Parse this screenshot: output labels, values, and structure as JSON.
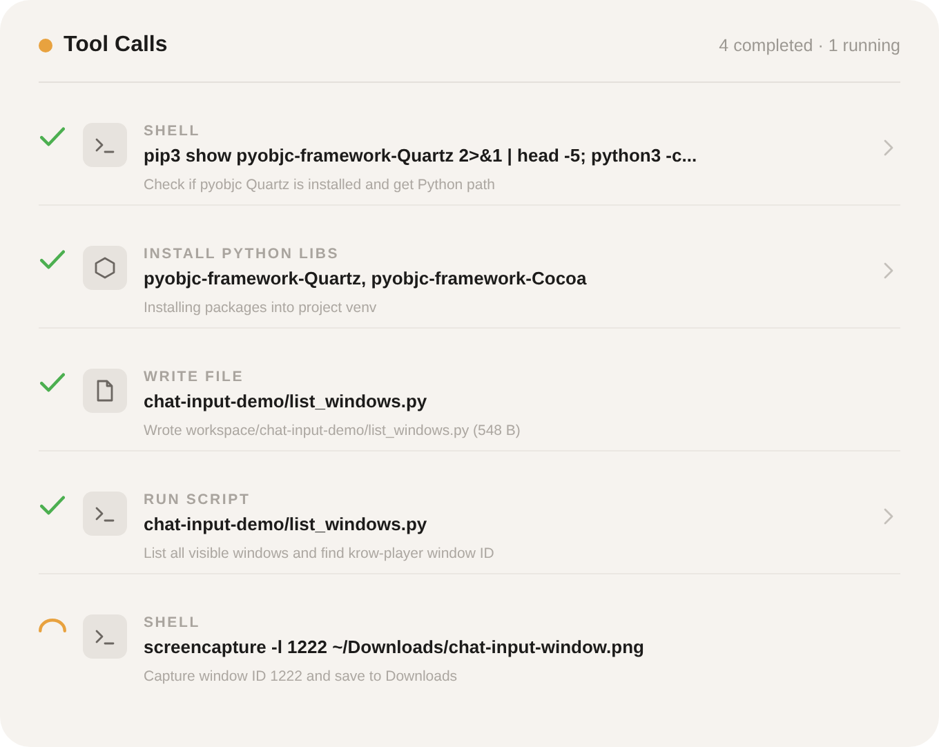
{
  "header": {
    "title": "Tool Calls",
    "summary": "4 completed · 1 running"
  },
  "calls": [
    {
      "running": false,
      "kind": "terminal",
      "label": "SHELL",
      "title": "pip3 show pyobjc-framework-Quartz 2>&1 | head -5; python3 -c...",
      "description": "Check if pyobjc Quartz is installed and get Python path",
      "expandable": true
    },
    {
      "running": false,
      "kind": "package",
      "label": "INSTALL PYTHON LIBS",
      "title": "pyobjc-framework-Quartz, pyobjc-framework-Cocoa",
      "description": "Installing packages into project venv",
      "expandable": true
    },
    {
      "running": false,
      "kind": "file",
      "label": "WRITE FILE",
      "title": "chat-input-demo/list_windows.py",
      "description": "Wrote workspace/chat-input-demo/list_windows.py (548 B)",
      "expandable": false
    },
    {
      "running": false,
      "kind": "terminal",
      "label": "RUN SCRIPT",
      "title": "chat-input-demo/list_windows.py",
      "description": "List all visible windows and find krow-player window ID",
      "expandable": true
    },
    {
      "running": true,
      "kind": "terminal",
      "label": "SHELL",
      "title": "screencapture -l 1222 ~/Downloads/chat-input-window.png",
      "description": "Capture window ID 1222 and save to Downloads",
      "expandable": false
    }
  ]
}
